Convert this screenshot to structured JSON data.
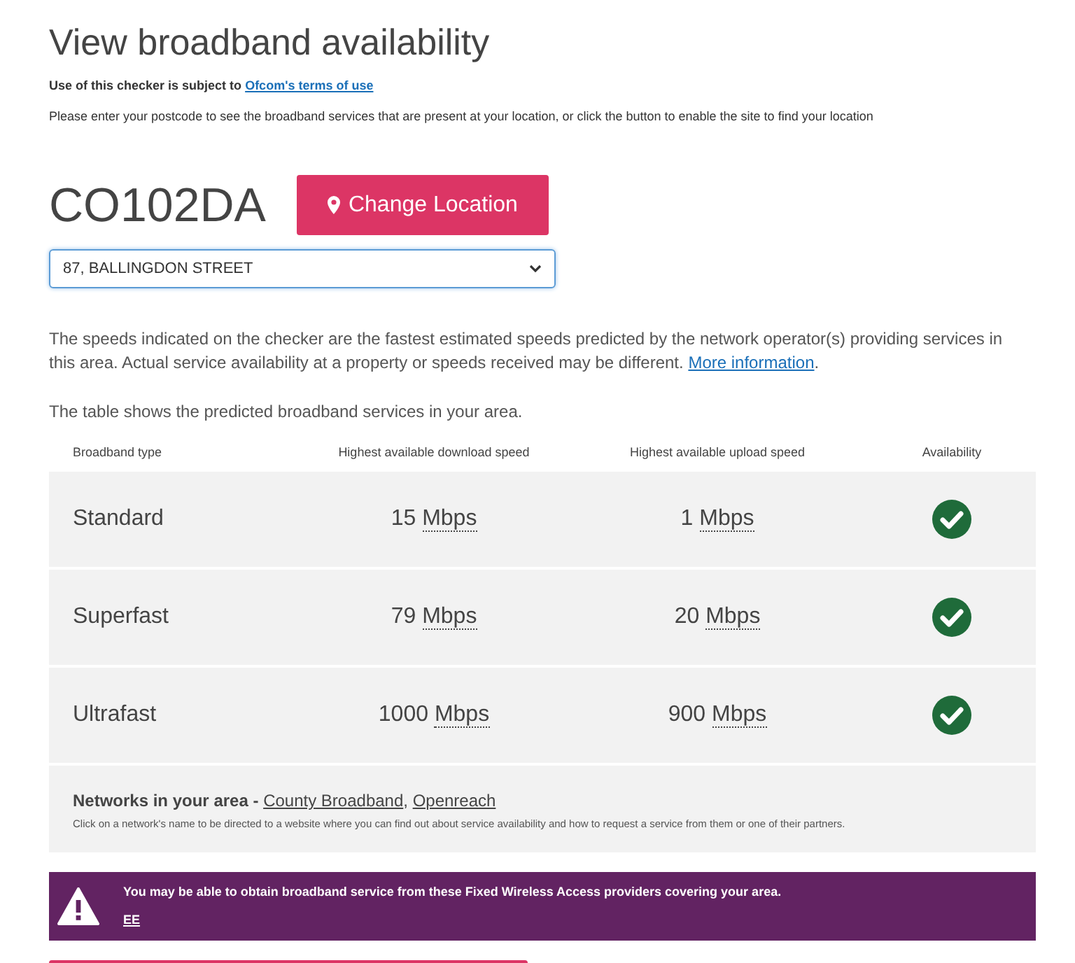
{
  "title": "View broadband availability",
  "terms": {
    "text": "Use of this checker is subject to",
    "link": "Ofcom's terms of use"
  },
  "instructions": "Please enter your postcode to see the broadband services that are present at your location, or click the button to enable the site to find your location",
  "postcode": "CO102DA",
  "change_button": "Change Location",
  "address_select": {
    "value": "87, BALLINGDON STREET"
  },
  "disclaimer": {
    "text": "The speeds indicated on the checker are the fastest estimated speeds predicted by the network operator(s) providing services in this area. Actual service availability at a property or speeds received may be different.",
    "link": "More information",
    "after": "."
  },
  "table_intro": "The table shows the predicted broadband services in your area.",
  "table": {
    "columns": [
      "Broadband type",
      "Highest available download speed",
      "Highest available upload speed",
      "Availability"
    ],
    "rows": [
      {
        "type": "Standard",
        "download": "15",
        "download_unit": "Mbps",
        "upload": "1",
        "upload_unit": "Mbps",
        "available": true
      },
      {
        "type": "Superfast",
        "download": "79",
        "download_unit": "Mbps",
        "upload": "20",
        "upload_unit": "Mbps",
        "available": true
      },
      {
        "type": "Ultrafast",
        "download": "1000",
        "download_unit": "Mbps",
        "upload": "900",
        "upload_unit": "Mbps",
        "available": true
      }
    ]
  },
  "networks": {
    "label": "Networks in your area -",
    "separator": ",",
    "links": [
      "County Broadband",
      "Openreach"
    ],
    "note": "Click on a network's name to be directed to a website where you can find out about service availability and how to request a service from them or one of their partners."
  },
  "fwa_notice": {
    "text": "You may be able to obtain broadband service from these Fixed Wireless Access providers covering your area.",
    "providers": [
      "EE"
    ]
  }
}
